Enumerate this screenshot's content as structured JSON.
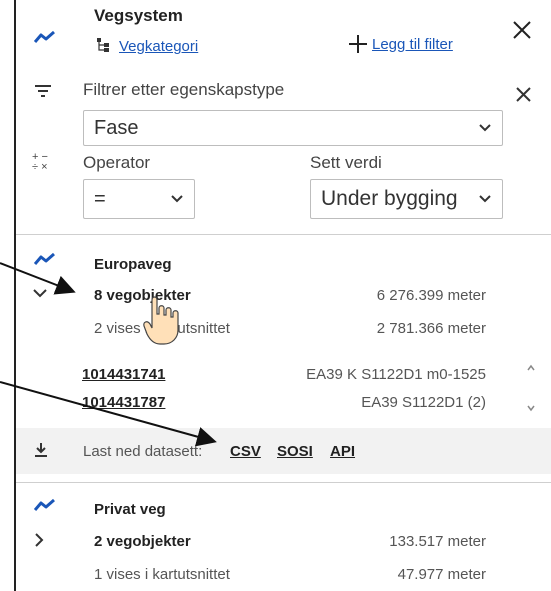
{
  "header": {
    "title": "Vegsystem",
    "category_link": "Vegkategori",
    "add_filter_label": "Legg til filter"
  },
  "filter": {
    "label": "Filtrer etter egenskapstype",
    "property_value": "Fase",
    "operator_label": "Operator",
    "operator_value": "=",
    "value_label": "Sett verdi",
    "value_value": "Under bygging"
  },
  "results": [
    {
      "name": "Europaveg",
      "count_label": "8 vegobjekter",
      "length": "6 276.399 meter",
      "visible_label": "2 vises i kartutsnittet",
      "visible_length": "2 781.366 meter",
      "objects": [
        {
          "id": "1014431741",
          "ref": "EA39 K S1122D1 m0-1525"
        },
        {
          "id": "1014431787",
          "ref": "EA39 S1122D1 (2)"
        }
      ]
    },
    {
      "name": "Privat veg",
      "count_label": "2 vegobjekter",
      "length": "133.517 meter",
      "visible_label": "1 vises i kartutsnittet",
      "visible_length": "47.977 meter"
    }
  ],
  "download": {
    "label": "Last ned datasett:",
    "formats": [
      "CSV",
      "SOSI",
      "API"
    ]
  },
  "colors": {
    "accent": "#1a56b8",
    "download_bar": "#f2f2f2"
  }
}
